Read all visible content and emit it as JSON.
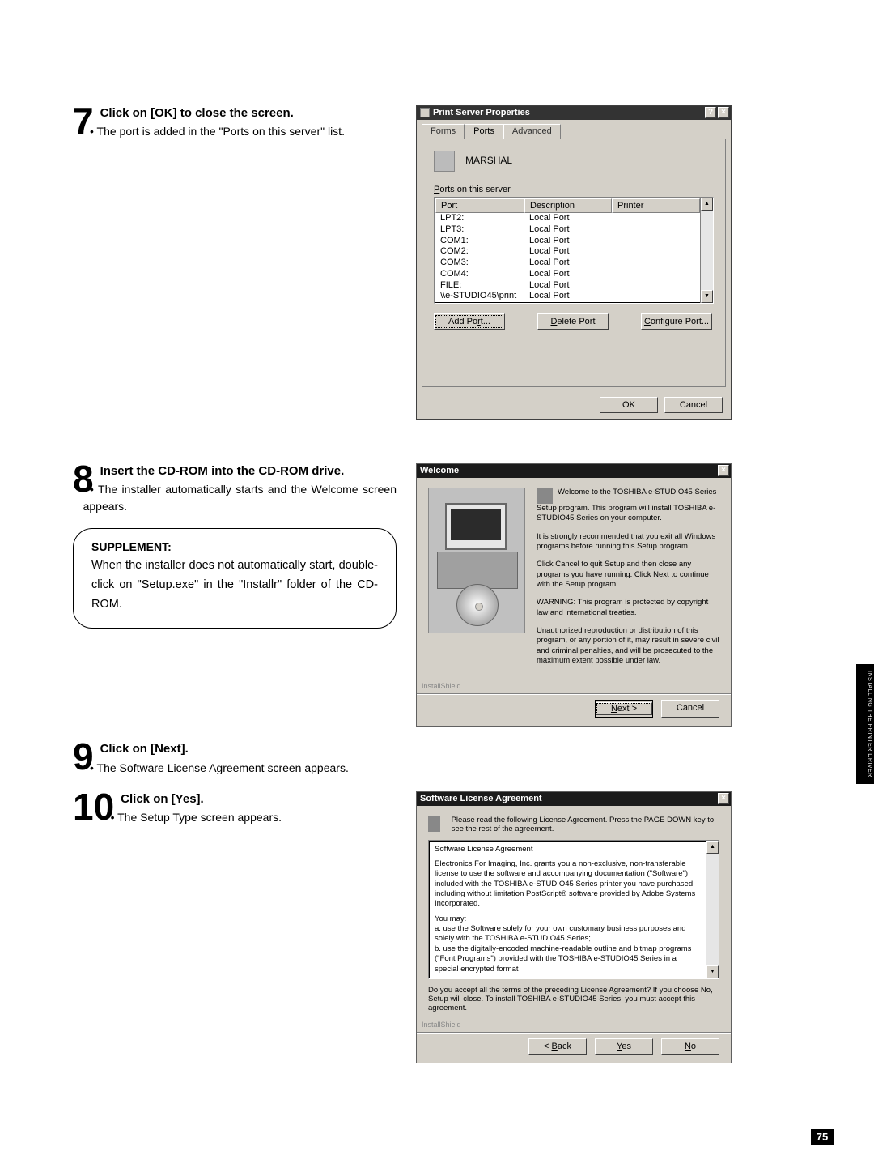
{
  "steps": {
    "s7": {
      "num": "7",
      "head": "Click on [OK] to close the screen.",
      "bullet": "The port is added in the \"Ports on this server\" list."
    },
    "s8": {
      "num": "8",
      "head": "Insert the CD-ROM into the CD-ROM drive.",
      "bullet": "The installer automatically starts and the Welcome screen appears."
    },
    "s9": {
      "num": "9",
      "head": "Click on [Next].",
      "bullet": "The Software License Agreement screen appears."
    },
    "s10": {
      "num": "10",
      "head": "Click on [Yes].",
      "bullet": "The Setup Type screen appears."
    }
  },
  "supplement": {
    "title": "SUPPLEMENT:",
    "body": "When the installer does not automatically start, double-click on \"Setup.exe\" in the \"Installr\" folder of the CD-ROM."
  },
  "sideTab": {
    "line1": "INSTALLING THE",
    "line2": "PRINTER DRIVER"
  },
  "pageNumber": "75",
  "win7": {
    "title": "Print Server Properties",
    "helpGlyph": "?",
    "closeGlyph": "×",
    "tabs": {
      "forms": "Forms",
      "ports": "Ports",
      "advanced": "Advanced"
    },
    "serverName": "MARSHAL",
    "portsLabel_pre": "P",
    "portsLabel_rest": "orts on this server",
    "columns": {
      "port": "Port",
      "desc": "Description",
      "printer": "Printer"
    },
    "rows": [
      {
        "port": "LPT2:",
        "desc": "Local Port",
        "printer": ""
      },
      {
        "port": "LPT3:",
        "desc": "Local Port",
        "printer": ""
      },
      {
        "port": "COM1:",
        "desc": "Local Port",
        "printer": ""
      },
      {
        "port": "COM2:",
        "desc": "Local Port",
        "printer": ""
      },
      {
        "port": "COM3:",
        "desc": "Local Port",
        "printer": ""
      },
      {
        "port": "COM4:",
        "desc": "Local Port",
        "printer": ""
      },
      {
        "port": "FILE:",
        "desc": "Local Port",
        "printer": ""
      },
      {
        "port": "\\\\e-STUDIO45\\print",
        "desc": "Local Port",
        "printer": ""
      }
    ],
    "btnAddPre": "Add Po",
    "btnAddU": "r",
    "btnAddPost": "t...",
    "btnDelU": "D",
    "btnDelRest": "elete Port",
    "btnCfgU": "C",
    "btnCfgRest": "onfigure Port...",
    "ok": "OK",
    "cancel": "Cancel",
    "scrollUp": "▲",
    "scrollDown": "▼"
  },
  "win8": {
    "title": "Welcome",
    "closeGlyph": "×",
    "p1": "Welcome to the TOSHIBA e-STUDIO45 Series Setup program. This program will install TOSHIBA e-STUDIO45 Series on your computer.",
    "p2": "It is strongly recommended that you exit all Windows programs before running this Setup program.",
    "p3": "Click Cancel to quit Setup and then close any programs you have running. Click Next to continue with the Setup program.",
    "p4": "WARNING: This program is protected by copyright law and international treaties.",
    "p5": "Unauthorized reproduction or distribution of this program, or any portion of it, may result in severe civil and criminal penalties, and will be prosecuted to the maximum extent possible under law.",
    "shield": "InstallShield",
    "nextPre": "N",
    "nextRest": "ext >",
    "cancel": "Cancel"
  },
  "win10": {
    "title": "Software License Agreement",
    "closeGlyph": "×",
    "intro": "Please read the following License Agreement. Press the PAGE DOWN key to see the rest of the agreement.",
    "h1": "Software License Agreement",
    "para1": "Electronics For Imaging, Inc. grants you a non-exclusive, non-transferable license to use the software and accompanying documentation (\"Software\") included with the TOSHIBA e-STUDIO45 Series printer you have purchased, including without limitation PostScript® software provided by Adobe Systems Incorporated.",
    "you": "You may:",
    "a": "a. use the Software solely for your own customary business purposes and solely with the TOSHIBA e-STUDIO45 Series;",
    "b": "b. use the digitally-encoded machine-readable outline and bitmap programs (\"Font Programs\") provided with the TOSHIBA e-STUDIO45 Series in a special encrypted format",
    "question": "Do you accept all the terms of the preceding License Agreement? If you choose No, Setup will close. To install TOSHIBA e-STUDIO45 Series, you must accept this agreement.",
    "shield": "InstallShield",
    "back": "< Back",
    "yes": "Yes",
    "no": "No",
    "backU": "B",
    "yesU": "Y",
    "noU": "N",
    "scrollUp": "▲",
    "scrollDown": "▼"
  }
}
